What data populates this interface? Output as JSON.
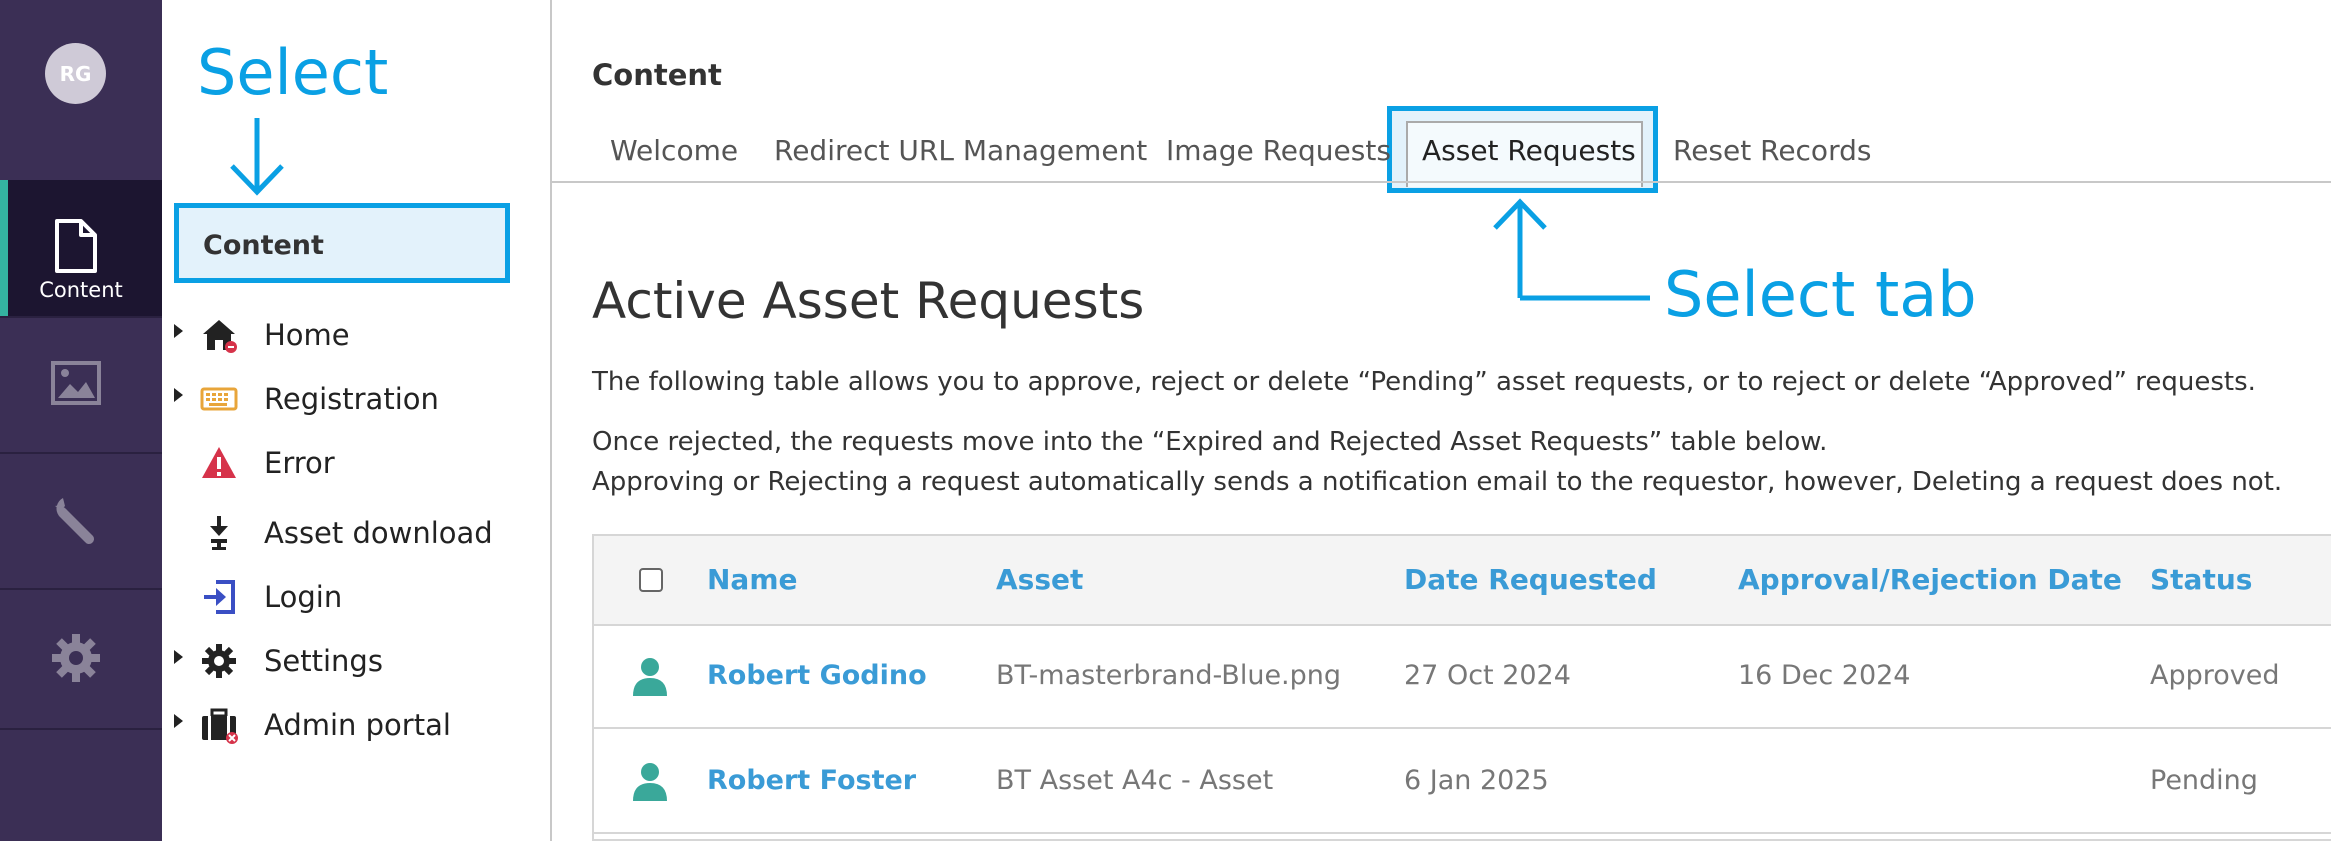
{
  "rail": {
    "avatar_initials": "RG",
    "active_label": "Content",
    "active_color": "#34b3a0"
  },
  "tree": {
    "selected": "Content",
    "items": [
      {
        "label": "Home",
        "icon": "home-icon",
        "expandable": true
      },
      {
        "label": "Registration",
        "icon": "keyboard-icon",
        "expandable": true
      },
      {
        "label": "Error",
        "icon": "warning-icon",
        "expandable": false
      },
      {
        "label": "Asset download",
        "icon": "download-icon",
        "expandable": false
      },
      {
        "label": "Login",
        "icon": "login-icon",
        "expandable": false
      },
      {
        "label": "Settings",
        "icon": "gear-icon",
        "expandable": true
      },
      {
        "label": "Admin portal",
        "icon": "briefcase-icon",
        "expandable": true
      }
    ]
  },
  "callouts": {
    "select": "Select",
    "select_tab": "Select tab",
    "color": "#0aa0e4"
  },
  "header": {
    "title": "Content",
    "tabs": [
      "Welcome",
      "Redirect URL Management",
      "Image Requests",
      "Asset Requests",
      "Reset Records"
    ],
    "active_tab": "Asset Requests"
  },
  "main": {
    "heading": "Active Asset Requests",
    "para1": "The following table allows you to approve, reject or delete “Pending” asset requests, or to reject or delete “Approved” requests.",
    "para2": "Once rejected, the requests move into the “Expired and Rejected Asset Requests” table below.",
    "para3": "Approving or Rejecting a request automatically sends a notification email to the requestor, however, Deleting a request does not."
  },
  "table": {
    "columns": [
      "Name",
      "Asset",
      "Date Requested",
      "Approval/Rejection Date",
      "Status"
    ],
    "rows": [
      {
        "name": "Robert Godino",
        "asset": "BT-masterbrand-Blue.png",
        "date_requested": "27 Oct 2024",
        "approval_date": "16 Dec 2024",
        "status": "Approved"
      },
      {
        "name": "Robert Foster",
        "asset": "BT Asset A4c - Asset",
        "date_requested": "6 Jan 2025",
        "approval_date": "",
        "status": "Pending"
      }
    ]
  }
}
